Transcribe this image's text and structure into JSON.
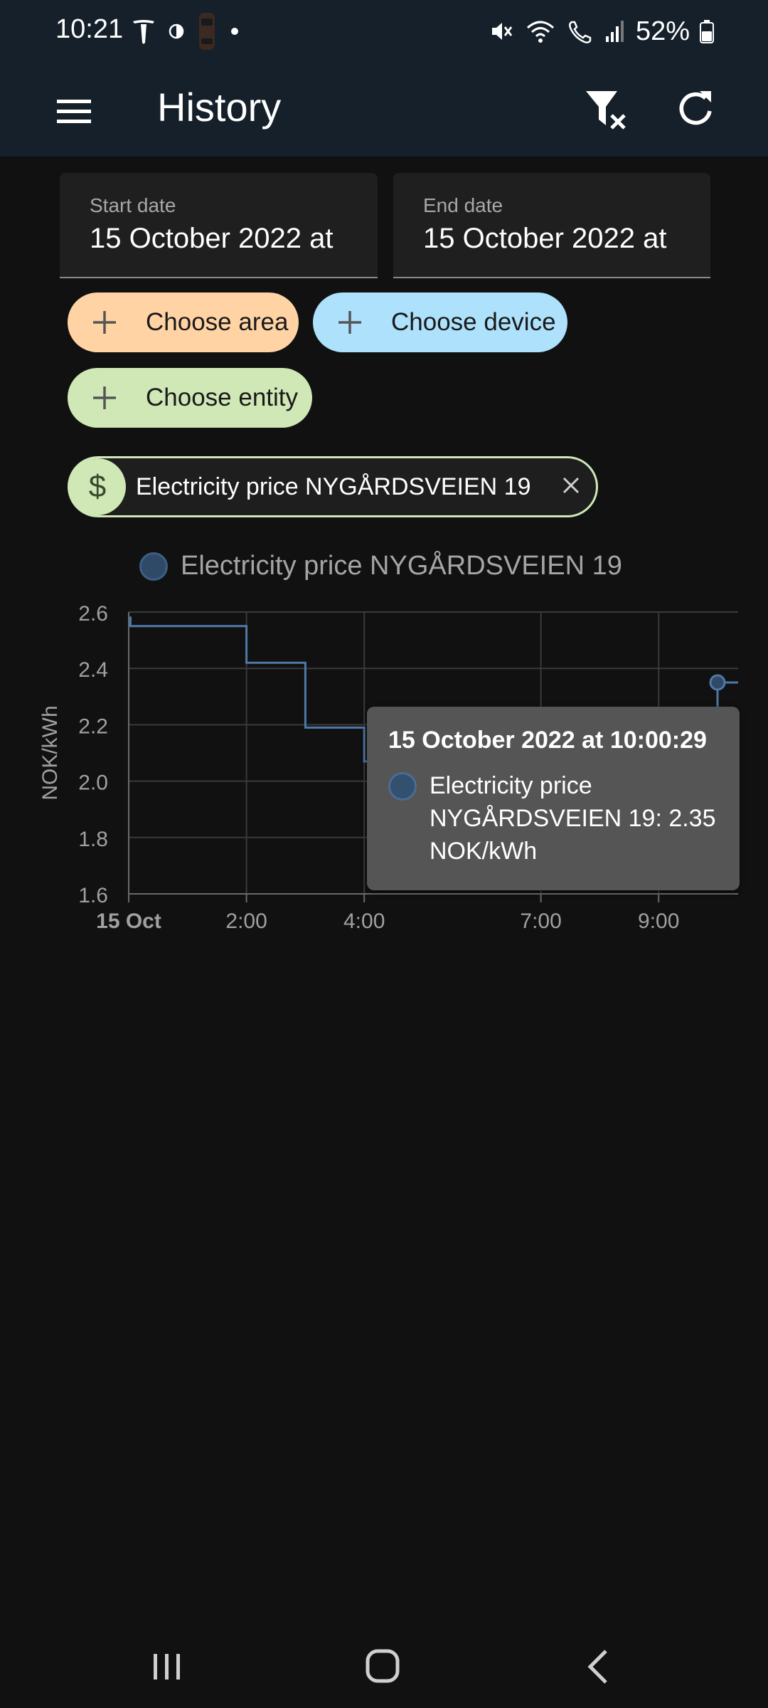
{
  "status_bar": {
    "time": "10:21",
    "battery_percent": "52%"
  },
  "app_bar": {
    "title": "History",
    "icons": [
      "menu-icon",
      "filter-clear-icon",
      "refresh-icon"
    ]
  },
  "date_range": {
    "start_label": "Start date",
    "start_value": "15 October 2022 at",
    "end_label": "End date",
    "end_value": "15 October 2022 at"
  },
  "target_chips": [
    {
      "label": "Choose area",
      "color": "#ffd3a4"
    },
    {
      "label": "Choose device",
      "color": "#aee1fb"
    },
    {
      "label": "Choose entity",
      "color": "#cfe8b6"
    }
  ],
  "selected_entity": {
    "label": "Electricity price NYGÅRDSVEIEN 19",
    "icon": "currency-usd-icon"
  },
  "tooltip": {
    "title": "15 October 2022 at 10:00:29",
    "line1": "Electricity price",
    "line2": "NYGÅRDSVEIEN 19: 2.35",
    "line3": "NOK/kWh"
  },
  "chart_data": {
    "type": "line",
    "step": true,
    "series": [
      {
        "name": "Electricity price NYGÅRDSVEIEN 19",
        "color": "#4e79a7",
        "points": [
          {
            "x": 0.0,
            "y": 2.58
          },
          {
            "x": 0.03,
            "y": 2.55
          },
          {
            "x": 2.0,
            "y": 2.42
          },
          {
            "x": 3.0,
            "y": 2.19
          },
          {
            "x": 4.0,
            "y": 2.07
          },
          {
            "x": 5.0,
            "y": 1.88
          },
          {
            "x": 6.0,
            "y": 1.8
          },
          {
            "x": 7.0,
            "y": 1.73
          },
          {
            "x": 8.0,
            "y": 1.88
          },
          {
            "x": 9.0,
            "y": 2.0
          },
          {
            "x": 10.0,
            "y": 2.35
          },
          {
            "x": 10.35,
            "y": 2.35
          }
        ]
      }
    ],
    "ylabel": "NOK/kWh",
    "ylim": [
      1.6,
      2.6
    ],
    "y_ticks": [
      "2.6",
      "2.4",
      "2.2",
      "2.0",
      "1.8",
      "1.6"
    ],
    "x_ticks": [
      {
        "x": 0,
        "label": "15 Oct",
        "bold": true
      },
      {
        "x": 2,
        "label": "2:00"
      },
      {
        "x": 4,
        "label": "4:00"
      },
      {
        "x": 7,
        "label": "7:00"
      },
      {
        "x": 9,
        "label": "9:00"
      }
    ],
    "xlim": [
      0,
      10.35
    ],
    "legend": "top-left",
    "grid": true,
    "highlight_point": {
      "x": 10.0,
      "y": 2.35
    }
  }
}
